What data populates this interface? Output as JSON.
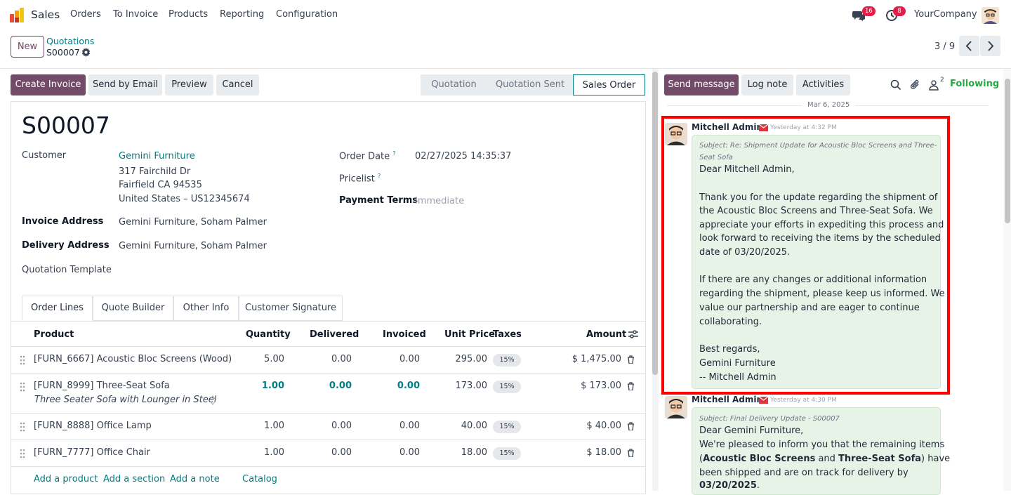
{
  "topnav": {
    "app_name": "Sales",
    "menu": [
      "Orders",
      "To Invoice",
      "Products",
      "Reporting",
      "Configuration"
    ],
    "messages_badge": "16",
    "activities_badge": "8",
    "company": "YourCompany"
  },
  "control": {
    "new_label": "New",
    "breadcrumb_parent": "Quotations",
    "breadcrumb_current": "S00007",
    "pager": "3 / 9"
  },
  "actions": {
    "create_invoice": "Create Invoice",
    "send_email": "Send by Email",
    "preview": "Preview",
    "cancel": "Cancel",
    "stages": [
      "Quotation",
      "Quotation Sent",
      "Sales Order"
    ],
    "active_stage": "Sales Order"
  },
  "form": {
    "title": "S00007",
    "customer_label": "Customer",
    "customer_name": "Gemini Furniture",
    "customer_address": [
      "317 Fairchild Dr",
      "Fairfield CA 94535",
      "United States – US12345674"
    ],
    "invoice_address_label": "Invoice Address",
    "invoice_address": "Gemini Furniture, Soham Palmer",
    "delivery_address_label": "Delivery Address",
    "delivery_address": "Gemini Furniture, Soham Palmer",
    "quotation_template_label": "Quotation Template",
    "order_date_label": "Order Date",
    "order_date": "02/27/2025 14:35:37",
    "pricelist_label": "Pricelist",
    "payment_terms_label": "Payment Terms",
    "payment_terms": "Immediate",
    "help_mark": "?"
  },
  "tabs": [
    "Order Lines",
    "Quote Builder",
    "Other Info",
    "Customer Signature"
  ],
  "table": {
    "headers": {
      "product": "Product",
      "quantity": "Quantity",
      "delivered": "Delivered",
      "invoiced": "Invoiced",
      "unit_price": "Unit Price",
      "taxes": "Taxes",
      "amount": "Amount"
    },
    "rows": [
      {
        "product": "[FURN_6667] Acoustic Bloc Screens (Wood)",
        "desc": "",
        "qty": "5.00",
        "delivered": "0.00",
        "invoiced": "0.00",
        "price": "295.00",
        "tax": "15%",
        "amount": "$ 1,475.00"
      },
      {
        "product": "[FURN_8999] Three-Seat Sofa",
        "desc": "Three Seater Sofa with Lounger in Steel",
        "qty": "1.00",
        "delivered": "0.00",
        "invoiced": "0.00",
        "price": "173.00",
        "tax": "15%",
        "amount": "$ 173.00"
      },
      {
        "product": "[FURN_8888] Office Lamp",
        "desc": "",
        "qty": "1.00",
        "delivered": "0.00",
        "invoiced": "0.00",
        "price": "40.00",
        "tax": "15%",
        "amount": "$ 40.00"
      },
      {
        "product": "[FURN_7777] Office Chair",
        "desc": "",
        "qty": "1.00",
        "delivered": "0.00",
        "invoiced": "0.00",
        "price": "18.00",
        "tax": "15%",
        "amount": "$ 18.00"
      }
    ],
    "add_links": [
      "Add a product",
      "Add a section",
      "Add a note",
      "Catalog"
    ]
  },
  "chatter": {
    "send_message": "Send message",
    "log_note": "Log note",
    "activities": "Activities",
    "followers_count": "2",
    "following": "Following",
    "date_sep": "Mar 6, 2025",
    "messages": [
      {
        "author": "Mitchell Admin",
        "time": "Yesterday at 4:32 PM",
        "subject": [
          "Subject: Re: Shipment Update for Acoustic Bloc Screens and Three-",
          "Seat Sofa"
        ],
        "lines": [
          "Dear Mitchell Admin,",
          "Thank you for the update regarding the shipment of",
          "the Acoustic Bloc Screens and Three-Seat Sofa. We",
          "appreciate your efforts in expediting this process and",
          "look forward to receiving the items by the scheduled",
          "date of 03/20/2025.",
          "If there are any changes or additional information",
          "regarding the shipment, please keep us informed. We",
          "value our partnership and are eager to continue",
          "collaborating.",
          "Best regards,",
          "Gemini Furniture",
          "-- Mitchell Admin"
        ]
      },
      {
        "author": "Mitchell Admin",
        "time": "Yesterday at 4:30 PM",
        "subject": [
          "Subject: Final Delivery Update - S00007"
        ],
        "lines": [
          "Dear Gemini Furniture,",
          "We're pleased to inform you that the remaining items"
        ],
        "line3": {
          "a": "(",
          "b": "Acoustic Bloc Screens",
          "c": " and ",
          "d": "Three-Seat Sofa",
          "e": ") have"
        },
        "line4": "been shipped and are on track for delivery by",
        "line5": {
          "date": "03/20/2025",
          "tail": "."
        }
      }
    ]
  },
  "colors": {
    "brand": "#714b67",
    "link": "#017e84",
    "highlight": "#ff0000",
    "following": "#28a745"
  }
}
